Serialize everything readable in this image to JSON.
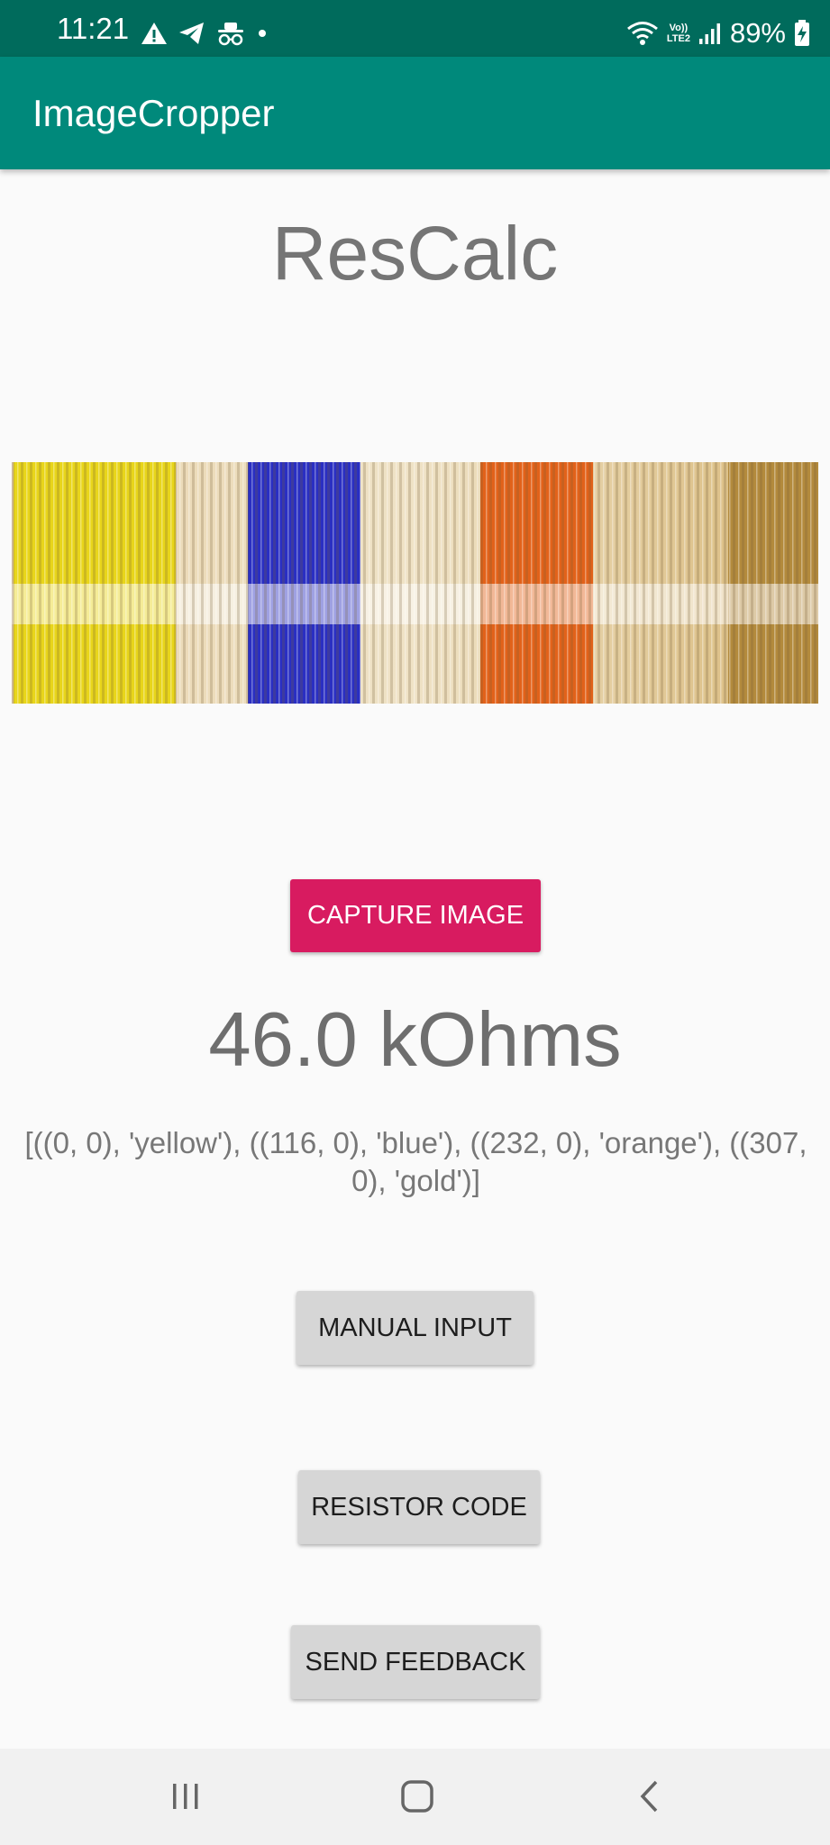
{
  "status_bar": {
    "time": "11:21",
    "notification_icons": [
      "warning-icon",
      "telegram-icon",
      "incognito-icon",
      "dot-icon"
    ],
    "volte_label": "Vo))",
    "lte_label": "LTE2",
    "battery_percent": "89%",
    "bg_color": "#006b5c"
  },
  "app_bar": {
    "title": "ImageCropper",
    "bg_color": "#00897b"
  },
  "main": {
    "heading": "ResCalc",
    "image": {
      "description_icon": "resistor-image",
      "bands": [
        "yellow",
        "blue",
        "orange",
        "gold"
      ]
    },
    "capture_button_label": "CAPTURE IMAGE",
    "capture_button_color": "#d81b60",
    "resistance_value": "46.0 kOhms",
    "detected_bands_text": "[((0, 0), 'yellow'), ((116, 0), 'blue'), ((232, 0), 'orange'), ((307, 0), 'gold')]",
    "manual_input_label": "MANUAL INPUT",
    "resistor_code_label": "RESISTOR CODE",
    "send_feedback_label": "SEND FEEDBACK"
  },
  "nav_bar": {
    "recents_icon": "recents-icon",
    "home_icon": "home-icon",
    "back_icon": "back-icon"
  }
}
